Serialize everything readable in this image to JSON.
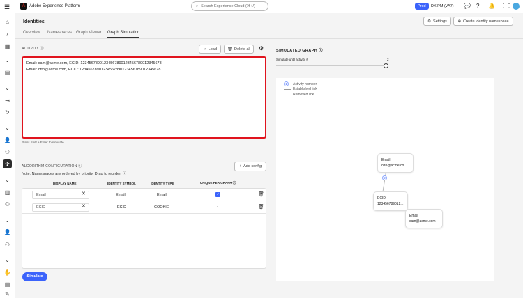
{
  "topbar": {
    "app_title": "Adobe Experience Platform",
    "search_placeholder": "Search Experience Cloud (⌘+/)",
    "env_badge": "Prod",
    "org": "DX PM (VA7)"
  },
  "page": {
    "title": "Identities",
    "settings_label": "Settings",
    "create_label": "Create identity namespace",
    "tabs": [
      "Overview",
      "Namespaces",
      "Graph Viewer",
      "Graph Simulation"
    ]
  },
  "activity": {
    "label": "ACTIVITY",
    "load_label": "Load",
    "delete_label": "Delete all",
    "lines": [
      "Email: sam@acme.com, ECID: 12345678901234567890123456789012345678",
      "Email: otto@acme.com, ECID: 12345678901234567890123456789012345678"
    ],
    "hint": "Press Shift + Enter to simulate."
  },
  "algo": {
    "label": "ALGORITHM CONFIGURATION",
    "note": "Note: Namespaces are ordered by priority. Drag to reorder.",
    "add_label": "Add config",
    "headers": [
      "DISPLAY NAME",
      "IDENTITY SYMBOL",
      "IDENTITY TYPE",
      "UNIQUE PER GRAPH"
    ],
    "rows": [
      {
        "name": "Email",
        "symbol": "Email",
        "type": "Email",
        "unique": "checked"
      },
      {
        "name": "ECID",
        "symbol": "ECID",
        "type": "COOKIE",
        "unique": "-"
      }
    ],
    "simulate_label": "Simulate"
  },
  "graph": {
    "label": "SIMULATED GRAPH",
    "slider_label": "Simulate until activity #",
    "slider_value": "2",
    "slider_fraction": 1.0,
    "legend": {
      "num": "1",
      "activity": "Activity number",
      "established": "Established link",
      "removed": "Removed link"
    },
    "nodes": [
      {
        "ns": "Email",
        "val": "otto@acme.co..."
      },
      {
        "ns": "ECID",
        "val": "123456789012..."
      },
      {
        "ns": "Email",
        "val": "sam@acme.com"
      }
    ],
    "edge_label": "2"
  }
}
